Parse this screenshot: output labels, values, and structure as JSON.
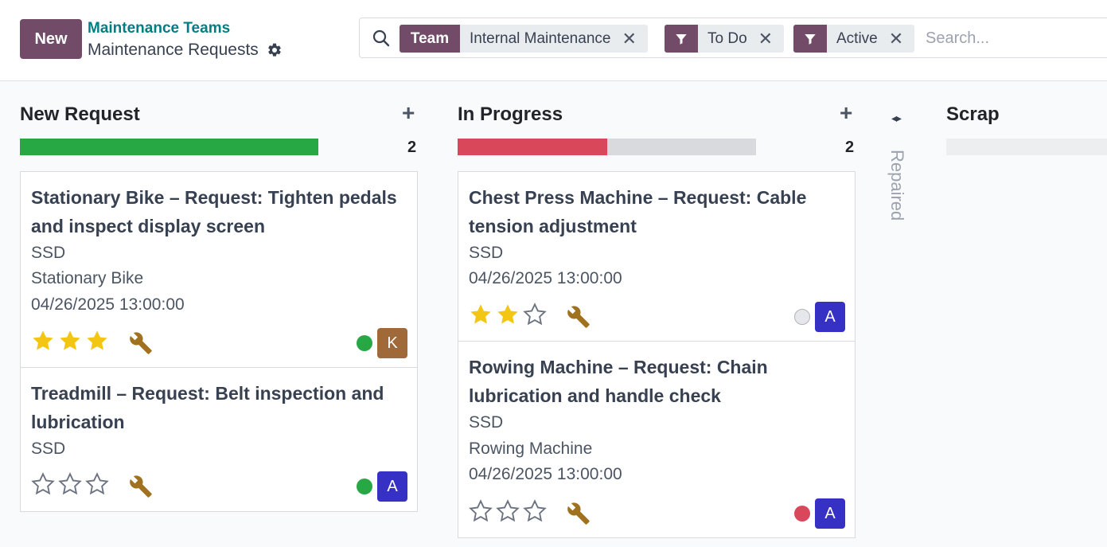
{
  "header": {
    "new_label": "New",
    "breadcrumb": "Maintenance Teams",
    "title": "Maintenance Requests",
    "gear_icon": "gear-icon"
  },
  "search": {
    "placeholder": "Search...",
    "facets": [
      {
        "tag": "Team",
        "value": "Internal Maintenance"
      },
      {
        "tag": "filter-icon",
        "value": "To Do"
      },
      {
        "tag": "filter-icon",
        "value": "Active"
      }
    ]
  },
  "colors": {
    "brand": "#714b67",
    "green": "#28a745",
    "red": "#d9475a",
    "star": "#f3c613",
    "wrench": "#a0711e"
  },
  "columns": [
    {
      "title": "New Request",
      "count": "2",
      "progress": [
        {
          "color": "#28a745",
          "fraction": 1.0
        }
      ],
      "cards": [
        {
          "title": "Stationary Bike – Request: Tighten pedals and inspect display screen",
          "lines": [
            "SSD",
            "Stationary Bike",
            "04/26/2025 13:00:00"
          ],
          "priority": 3,
          "status": "green",
          "avatar": "K",
          "avatar_color": "#a0693a"
        },
        {
          "title": "Treadmill – Request: Belt inspection and lubrication",
          "lines": [
            "SSD"
          ],
          "priority": 0,
          "status": "green",
          "avatar": "A",
          "avatar_color": "#3730c4"
        }
      ]
    },
    {
      "title": "In Progress",
      "count": "2",
      "progress": [
        {
          "color": "#d9475a",
          "fraction": 0.5
        }
      ],
      "cards": [
        {
          "title": "Chest Press Machine – Request: Cable tension adjustment",
          "lines": [
            "SSD",
            "04/26/2025 13:00:00"
          ],
          "priority": 2,
          "status": "grey",
          "avatar": "A",
          "avatar_color": "#3730c4"
        },
        {
          "title": "Rowing Machine – Request: Chain lubrication and handle check",
          "lines": [
            "SSD",
            "Rowing Machine",
            "04/26/2025 13:00:00"
          ],
          "priority": 0,
          "status": "red",
          "avatar": "A",
          "avatar_color": "#3730c4"
        }
      ]
    },
    {
      "title": "Repaired",
      "folded": true
    },
    {
      "title": "Scrap",
      "progress": []
    }
  ]
}
